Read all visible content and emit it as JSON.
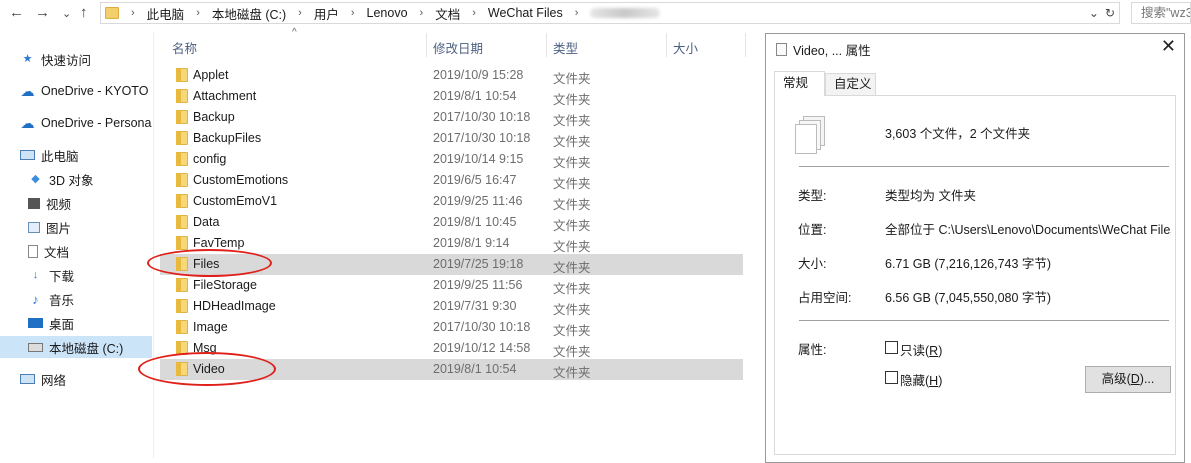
{
  "nav": {
    "back": "←",
    "forward": "→",
    "recent": "⌄",
    "up": "↑"
  },
  "address": {
    "crumbs": [
      "此电脑",
      "本地磁盘 (C:)",
      "用户",
      "Lenovo",
      "文档",
      "WeChat Files"
    ],
    "separator": "›",
    "dropdown": "⌄",
    "refresh": "↻"
  },
  "search": {
    "placeholder": "搜索\"wz3"
  },
  "sidebar": {
    "quick_access": "快速访问",
    "onedrive1": "OneDrive - KYOTO",
    "onedrive2": "OneDrive - Persona",
    "this_pc": "此电脑",
    "items": [
      "3D 对象",
      "视频",
      "图片",
      "文档",
      "下载",
      "音乐",
      "桌面",
      "本地磁盘 (C:)"
    ],
    "network": "网络"
  },
  "columns": {
    "name": "名称",
    "date": "修改日期",
    "type": "类型",
    "size": "大小",
    "sort_arrow": "^"
  },
  "files": [
    {
      "name": "Applet",
      "date": "2019/10/9 15:28",
      "type": "文件夹"
    },
    {
      "name": "Attachment",
      "date": "2019/8/1 10:54",
      "type": "文件夹"
    },
    {
      "name": "Backup",
      "date": "2017/10/30 10:18",
      "type": "文件夹"
    },
    {
      "name": "BackupFiles",
      "date": "2017/10/30 10:18",
      "type": "文件夹"
    },
    {
      "name": "config",
      "date": "2019/10/14 9:15",
      "type": "文件夹"
    },
    {
      "name": "CustomEmotions",
      "date": "2019/6/5 16:47",
      "type": "文件夹"
    },
    {
      "name": "CustomEmoV1",
      "date": "2019/9/25 11:46",
      "type": "文件夹"
    },
    {
      "name": "Data",
      "date": "2019/8/1 10:45",
      "type": "文件夹"
    },
    {
      "name": "FavTemp",
      "date": "2019/8/1 9:14",
      "type": "文件夹"
    },
    {
      "name": "Files",
      "date": "2019/7/25 19:18",
      "type": "文件夹"
    },
    {
      "name": "FileStorage",
      "date": "2019/9/25 11:56",
      "type": "文件夹"
    },
    {
      "name": "HDHeadImage",
      "date": "2019/7/31 9:30",
      "type": "文件夹"
    },
    {
      "name": "Image",
      "date": "2017/10/30 10:18",
      "type": "文件夹"
    },
    {
      "name": "Msg",
      "date": "2019/10/12 14:58",
      "type": "文件夹"
    },
    {
      "name": "Video",
      "date": "2019/8/1 10:54",
      "type": "文件夹"
    }
  ],
  "dialog": {
    "title": "Video, ... 属性",
    "close": "✕",
    "tabs": [
      "常规",
      "自定义"
    ],
    "summary": "3,603 个文件，2 个文件夹",
    "type_label": "类型:",
    "type_value": "类型均为 文件夹",
    "location_label": "位置:",
    "location_value": "全部位于 C:\\Users\\Lenovo\\Documents\\WeChat Files\\",
    "size_label": "大小:",
    "size_value": "6.71 GB (7,216,126,743 字节)",
    "disk_label": "占用空间:",
    "disk_value": "6.56 GB (7,045,550,080 字节)",
    "attr_label": "属性:",
    "readonly": {
      "text": "只读(",
      "key": "R",
      "end": ")"
    },
    "hidden": {
      "text": "隐藏(",
      "key": "H",
      "end": ")"
    },
    "advanced": {
      "text": "高级(",
      "key": "D",
      "end": ")..."
    }
  }
}
